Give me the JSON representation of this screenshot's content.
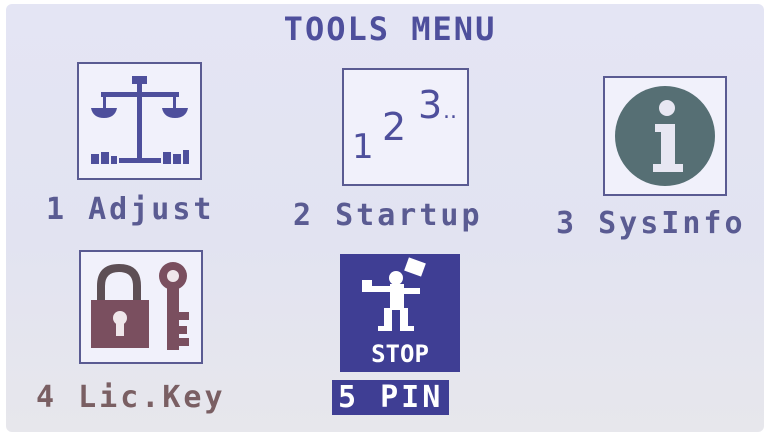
{
  "menu": {
    "title": "TOOLS MENU",
    "items": [
      {
        "label": "1 Adjust",
        "icon": "scale-icon"
      },
      {
        "label": "2 Startup",
        "icon": "startup-123-icon"
      },
      {
        "label": "3 SysInfo",
        "icon": "info-icon"
      },
      {
        "label": "4 Lic.Key",
        "icon": "lock-key-icon"
      },
      {
        "label": "5 PIN",
        "icon": "stop-pin-icon",
        "selected": true,
        "badge": "STOP"
      }
    ]
  },
  "colors": {
    "accent": "#3f3e94",
    "text": "#5a5b92",
    "background": "#e4e5f4",
    "lock": "#7a5f63"
  }
}
